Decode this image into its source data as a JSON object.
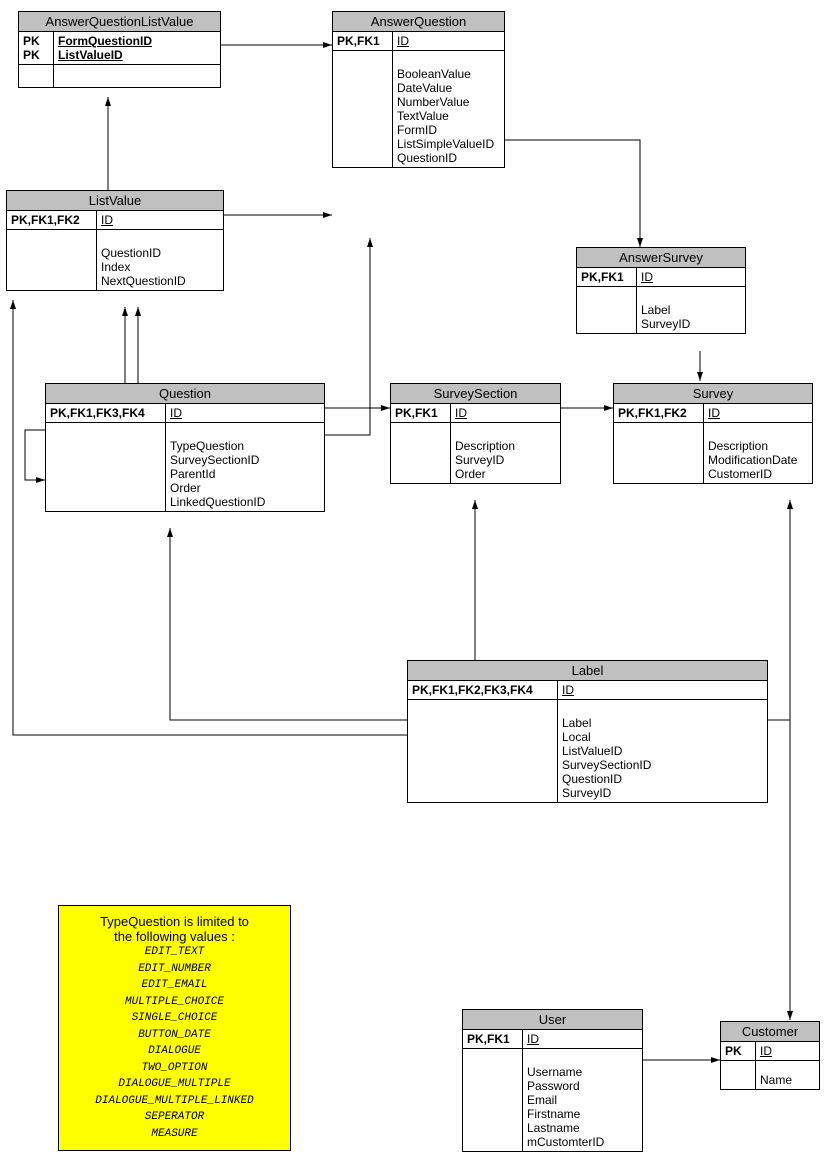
{
  "entities": {
    "answerQuestionListValue": {
      "title": "AnswerQuestionListValue",
      "keys": [
        "PK",
        "PK"
      ],
      "keyAttrs": [
        "FormQuestionID",
        "ListValueID"
      ]
    },
    "answerQuestion": {
      "title": "AnswerQuestion",
      "keyLabel": "PK,FK1",
      "id": "ID",
      "attrs": [
        "BooleanValue",
        "DateValue",
        "NumberValue",
        "TextValue",
        "FormID",
        "ListSimpleValueID",
        "QuestionID"
      ]
    },
    "listValue": {
      "title": "ListValue",
      "keyLabel": "PK,FK1,FK2",
      "id": "ID",
      "attrs": [
        "QuestionID",
        "Index",
        "NextQuestionID"
      ]
    },
    "answerSurvey": {
      "title": "AnswerSurvey",
      "keyLabel": "PK,FK1",
      "id": "ID",
      "attrs": [
        "Label",
        "SurveyID"
      ]
    },
    "question": {
      "title": "Question",
      "keyLabel": "PK,FK1,FK3,FK4",
      "id": "ID",
      "attrs": [
        "TypeQuestion",
        "SurveySectionID",
        "ParentId",
        "Order",
        "LinkedQuestionID"
      ]
    },
    "surveySection": {
      "title": "SurveySection",
      "keyLabel": "PK,FK1",
      "id": "ID",
      "attrs": [
        "Description",
        "SurveyID",
        "Order"
      ]
    },
    "survey": {
      "title": "Survey",
      "keyLabel": "PK,FK1,FK2",
      "id": "ID",
      "attrs": [
        "Description",
        "ModificationDate",
        "CustomerID"
      ]
    },
    "label": {
      "title": "Label",
      "keyLabel": "PK,FK1,FK2,FK3,FK4",
      "id": "ID",
      "attrs": [
        "Label",
        "Local",
        "ListValueID",
        "SurveySectionID",
        "QuestionID",
        "SurveyID"
      ]
    },
    "user": {
      "title": "User",
      "keyLabel": "PK,FK1",
      "id": "ID",
      "attrs": [
        "Username",
        "Password",
        "Email",
        "Firstname",
        "Lastname",
        "mCustomterID"
      ]
    },
    "customer": {
      "title": "Customer",
      "keyLabel": "PK",
      "id": "ID",
      "attrs": [
        "Name"
      ]
    }
  },
  "note": {
    "heading1": "TypeQuestion is limited to",
    "heading2": "the following values :",
    "values": [
      "EDIT_TEXT",
      "EDIT_NUMBER",
      "EDIT_EMAIL",
      "MULTIPLE_CHOICE",
      "SINGLE_CHOICE",
      "BUTTON_DATE",
      "DIALOGUE",
      "TWO_OPTION",
      "DIALOGUE_MULTIPLE",
      "DIALOGUE_MULTIPLE_LINKED",
      "SEPERATOR",
      "MEASURE"
    ]
  }
}
